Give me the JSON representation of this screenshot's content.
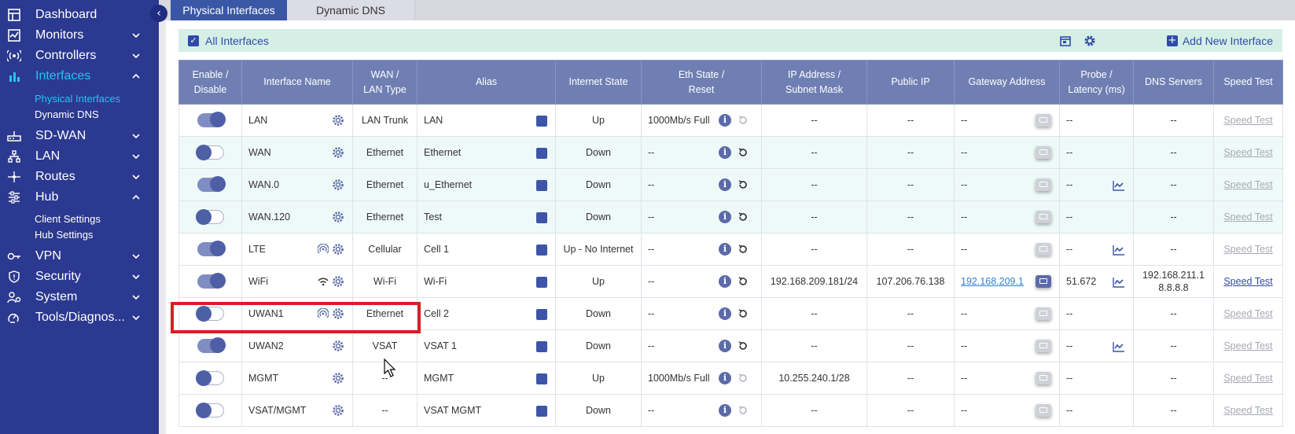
{
  "sidebar": {
    "items": [
      {
        "label": "Dashboard",
        "icon": "dashboard-icon"
      },
      {
        "label": "Monitors",
        "icon": "monitors-icon"
      },
      {
        "label": "Controllers",
        "icon": "controllers-icon"
      },
      {
        "label": "Interfaces",
        "icon": "interfaces-icon",
        "active": true
      },
      {
        "label": "SD-WAN",
        "icon": "sdwan-icon"
      },
      {
        "label": "LAN",
        "icon": "lan-icon"
      },
      {
        "label": "Routes",
        "icon": "routes-icon"
      },
      {
        "label": "Hub",
        "icon": "hub-icon"
      },
      {
        "label": "VPN",
        "icon": "vpn-icon"
      },
      {
        "label": "Security",
        "icon": "security-icon"
      },
      {
        "label": "System",
        "icon": "system-icon"
      },
      {
        "label": "Tools/Diagnos...",
        "icon": "tools-icon"
      }
    ],
    "interfaces_sub": [
      "Physical Interfaces",
      "Dynamic DNS"
    ],
    "hub_sub": [
      "Client Settings",
      "Hub Settings"
    ]
  },
  "tabs": [
    "Physical Interfaces",
    "Dynamic DNS"
  ],
  "filter": {
    "label": "All Interfaces",
    "add_label": "Add New Interface"
  },
  "table": {
    "headers": {
      "enable": [
        "Enable /",
        "Disable"
      ],
      "name": "Interface Name",
      "type": [
        "WAN /",
        "LAN Type"
      ],
      "alias": "Alias",
      "internet": "Internet State",
      "eth": [
        "Eth State /",
        "Reset"
      ],
      "ip": [
        "IP Address /",
        "Subnet Mask"
      ],
      "public_ip": "Public IP",
      "gateway": "Gateway Address",
      "probe": [
        "Probe /",
        "Latency (ms)"
      ],
      "dns": "DNS Servers",
      "speed": "Speed Test"
    },
    "rows": [
      {
        "name": "LAN",
        "type": "LAN Trunk",
        "alias": "LAN",
        "internet": "Up",
        "eth": "1000Mb/s Full",
        "ip": "--",
        "public_ip": "--",
        "gateway": "--",
        "probe": "--",
        "dns": "--",
        "speed": "Speed Test"
      },
      {
        "name": "WAN",
        "type": "Ethernet",
        "alias": "Ethernet",
        "internet": "Down",
        "eth": "--",
        "ip": "--",
        "public_ip": "--",
        "gateway": "--",
        "probe": "--",
        "dns": "--",
        "speed": "Speed Test"
      },
      {
        "name": "WAN.0",
        "type": "Ethernet",
        "alias": "u_Ethernet",
        "internet": "Down",
        "eth": "--",
        "ip": "--",
        "public_ip": "--",
        "gateway": "--",
        "probe": "--",
        "dns": "--",
        "speed": "Speed Test"
      },
      {
        "name": "WAN.120",
        "type": "Ethernet",
        "alias": "Test",
        "internet": "Down",
        "eth": "--",
        "ip": "--",
        "public_ip": "--",
        "gateway": "--",
        "probe": "--",
        "dns": "--",
        "speed": "Speed Test"
      },
      {
        "name": "LTE",
        "type": "Cellular",
        "alias": "Cell 1",
        "internet": "Up - No Internet",
        "eth": "--",
        "ip": "--",
        "public_ip": "--",
        "gateway": "--",
        "probe": "--",
        "dns": "--",
        "speed": "Speed Test"
      },
      {
        "name": "WiFi",
        "type": "Wi-Fi",
        "alias": "Wi-Fi",
        "internet": "Up",
        "eth": "--",
        "ip": "192.168.209.181/24",
        "public_ip": "107.206.76.138",
        "gateway": "192.168.209.1",
        "probe": "51.672",
        "dns1": "192.168.211.1",
        "dns2": "8.8.8.8",
        "speed": "Speed Test"
      },
      {
        "name": "UWAN1",
        "type": "Ethernet",
        "alias": "Cell 2",
        "internet": "Down",
        "eth": "--",
        "ip": "--",
        "public_ip": "--",
        "gateway": "--",
        "probe": "--",
        "dns": "--",
        "speed": "Speed Test"
      },
      {
        "name": "UWAN2",
        "type": "VSAT",
        "alias": "VSAT 1",
        "internet": "Down",
        "eth": "--",
        "ip": "--",
        "public_ip": "--",
        "gateway": "--",
        "probe": "--",
        "dns": "--",
        "speed": "Speed Test"
      },
      {
        "name": "MGMT",
        "type": "--",
        "alias": "MGMT",
        "internet": "Up",
        "eth": "1000Mb/s Full",
        "ip": "10.255.240.1/28",
        "public_ip": "--",
        "gateway": "--",
        "probe": "--",
        "dns": "--",
        "speed": "Speed Test"
      },
      {
        "name": "VSAT/MGMT",
        "type": "--",
        "alias": "VSAT MGMT",
        "internet": "Down",
        "eth": "--",
        "ip": "--",
        "public_ip": "--",
        "gateway": "--",
        "probe": "--",
        "dns": "--",
        "speed": "Speed Test"
      }
    ]
  },
  "colors": {
    "sidebar_bg": "#2b3990",
    "accent": "#29c3f0",
    "header_bg": "#6f7fb3",
    "highlight": "#d91f26"
  }
}
